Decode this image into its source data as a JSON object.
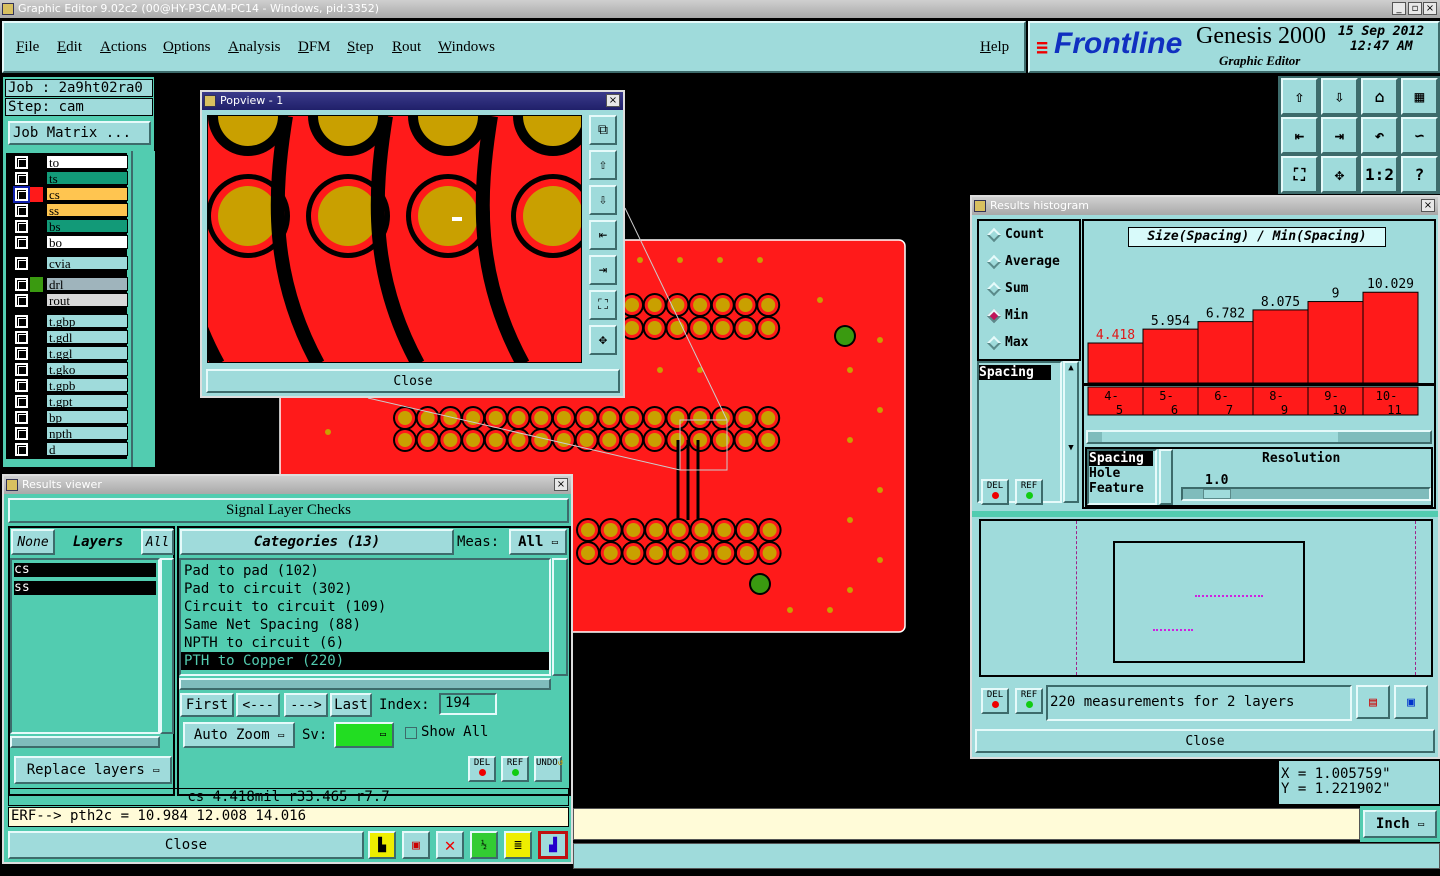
{
  "window": {
    "title": "Graphic Editor 9.02c2 (00@HY-P3CAM-PC14 - Windows, pid:3352)"
  },
  "menu": {
    "items": [
      "File",
      "Edit",
      "Actions",
      "Options",
      "Analysis",
      "DFM",
      "Step",
      "Rout",
      "Windows"
    ],
    "help": "Help"
  },
  "logo": {
    "brand": "Frontline",
    "product": "Genesis 2000",
    "subtitle": "Graphic Editor",
    "date": "15 Sep 2012",
    "time": "12:47 AM"
  },
  "job": {
    "job_label": "Job : 2a9ht02ra0",
    "step_label": "Step: cam",
    "matrix_button": "Job Matrix ..."
  },
  "layers": [
    {
      "name": "to",
      "color": "#ffffff"
    },
    {
      "name": "ts",
      "color": "#129a78"
    },
    {
      "name": "cs",
      "color": "#ffc550",
      "active": true,
      "swatch": "#ff1a1a"
    },
    {
      "name": "ss",
      "color": "#ffc550"
    },
    {
      "name": "bs",
      "color": "#129a78"
    },
    {
      "name": "bo",
      "color": "#ffffff"
    },
    {
      "name": "cvia",
      "color": "#9fdbdb"
    },
    {
      "name": "drl",
      "color": "#9fb4bc",
      "swatch": "#3a9a10"
    },
    {
      "name": "rout",
      "color": "#d8d8d8"
    },
    {
      "name": "t.gbp",
      "color": "#9fdbdb"
    },
    {
      "name": "t.gdl",
      "color": "#9fdbdb"
    },
    {
      "name": "t.ggl",
      "color": "#9fdbdb"
    },
    {
      "name": "t.gko",
      "color": "#9fdbdb"
    },
    {
      "name": "t.gpb",
      "color": "#9fdbdb"
    },
    {
      "name": "t.gpt",
      "color": "#9fdbdb"
    },
    {
      "name": "bp",
      "color": "#9fdbdb"
    },
    {
      "name": "npth",
      "color": "#9fdbdb"
    },
    {
      "name": "d",
      "color": "#9fdbdb"
    }
  ],
  "toolbar": {
    "icons": [
      "zoom-out-up-icon",
      "zoom-down-icon",
      "home-icon",
      "grid-xy-icon",
      "pan-left-icon",
      "pan-right-icon",
      "undo-zoom-icon",
      "snap-icon",
      "fit-all-icon",
      "center-icon",
      "scale-1-2-icon",
      "help-icon"
    ],
    "scale_label": "1:2",
    "help_label": "?"
  },
  "popview": {
    "title": "Popview - 1",
    "close": "Close"
  },
  "histogram": {
    "title": "Results histogram",
    "radios": [
      {
        "label": "Count",
        "on": false
      },
      {
        "label": "Average",
        "on": false
      },
      {
        "label": "Sum",
        "on": false
      },
      {
        "label": "Min",
        "on": true
      },
      {
        "label": "Max",
        "on": false
      }
    ],
    "type_list": [
      "Spacing"
    ],
    "del": "DEL",
    "ref": "REF",
    "source_list": [
      "Spacing",
      "Hole",
      "Feature"
    ],
    "resolution_label": "Resolution",
    "resolution_value": "1.0",
    "measurements": "220 measurements for 2 layers",
    "close": "Close"
  },
  "chart_data": {
    "type": "bar",
    "title": "Size(Spacing) / Min(Spacing)",
    "categories": [
      "4-5",
      "5-6",
      "6-7",
      "8-9",
      "9-10",
      "10-11"
    ],
    "values": [
      4.418,
      5.954,
      6.782,
      8.075,
      9,
      10.029
    ],
    "labels": [
      "4.418",
      "5.954",
      "6.782",
      "8.075",
      "9",
      "10.029"
    ],
    "highlight_color": "#e01818",
    "bar_color": "#ff1a1a"
  },
  "results": {
    "title": "Results viewer",
    "header": "Signal Layer Checks",
    "none": "None",
    "layers": "Layers",
    "all": "All",
    "layer_list": [
      "cs",
      "ss"
    ],
    "categories_label": "Categories (13)",
    "meas_label": "Meas:",
    "meas_value": "All",
    "categories": [
      "Pad to pad (102)",
      "Pad to circuit (302)",
      "Circuit to circuit (109)",
      "Same Net Spacing (88)",
      "NPTH to circuit (6)",
      "PTH to Copper (220)"
    ],
    "first": "First",
    "prev": "<---",
    "next": "--->",
    "last": "Last",
    "index_label": "Index:",
    "index_value": "194",
    "auto_zoom": "Auto Zoom",
    "sv_label": "Sv:",
    "sv_color": "#22dd22",
    "show_all": "Show All",
    "replace_layers": "Replace layers",
    "del": "DEL",
    "ref": "REF",
    "undo": "UNDO",
    "status": "cs 4.418mil  r33.465  r7.7",
    "erf": "ERF--> pth2c = 10.984 12.008 14.016",
    "close": "Close"
  },
  "coords": {
    "x": "X = 1.005759\"",
    "y": "Y = 1.221902\""
  },
  "units": "Inch"
}
